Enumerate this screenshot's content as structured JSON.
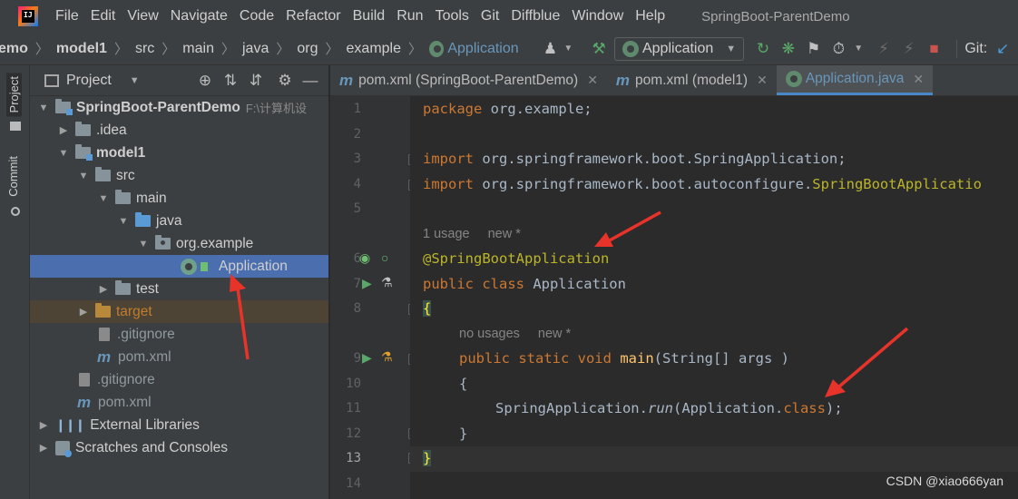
{
  "menubar": {
    "items": [
      "File",
      "Edit",
      "View",
      "Navigate",
      "Code",
      "Refactor",
      "Build",
      "Run",
      "Tools",
      "Git",
      "Diffblue",
      "Window",
      "Help"
    ],
    "window_title": "SpringBoot-ParentDemo"
  },
  "breadcrumb": {
    "project_fragment": "emo",
    "items": [
      "model1",
      "src",
      "main",
      "java",
      "org",
      "example"
    ],
    "current": "Application"
  },
  "toolbar": {
    "run_config": "Application",
    "git_label": "Git:"
  },
  "left_strip": {
    "project_tab": "Project",
    "commit_tab": "Commit"
  },
  "project_panel": {
    "title": "Project",
    "tree": [
      {
        "label": "SpringBoot-ParentDemo",
        "hint": "F:\\计算机设"
      },
      {
        "label": ".idea"
      },
      {
        "label": "model1"
      },
      {
        "label": "src"
      },
      {
        "label": "main"
      },
      {
        "label": "java"
      },
      {
        "label": "org.example"
      },
      {
        "label": "Application"
      },
      {
        "label": "test"
      },
      {
        "label": "target"
      },
      {
        "label": ".gitignore"
      },
      {
        "label": "pom.xml"
      },
      {
        "label": ".gitignore"
      },
      {
        "label": "pom.xml"
      },
      {
        "label": "External Libraries"
      },
      {
        "label": "Scratches and Consoles"
      }
    ]
  },
  "editor": {
    "tabs": [
      {
        "label": "pom.xml (SpringBoot-ParentDemo)"
      },
      {
        "label": "pom.xml (model1)"
      },
      {
        "label": "Application.java"
      }
    ],
    "line_numbers": [
      "1",
      "2",
      "3",
      "4",
      "5",
      "6",
      "7",
      "8",
      "9",
      "10",
      "11",
      "12",
      "13",
      "14"
    ],
    "hints": {
      "usage": "1 usage",
      "new_1": "new *",
      "no_usages": "no usages",
      "new_2": "new *"
    },
    "code": {
      "l1_kw": "package",
      "l1_rest": " org.example;",
      "l3_kw": "import",
      "l3_rest": " org.springframework.boot.SpringApplication;",
      "l4_kw": "import",
      "l4_rest": " org.springframework.boot.autoconfigure.",
      "l4_ann": "SpringBootApplicatio",
      "l6": "@SpringBootApplication",
      "l7_kw": "public class",
      "l7_rest": " Application",
      "l8": "{",
      "l9_kw": "public static void",
      "l9_fn": "main",
      "l9_rest": "(String[] args )",
      "l10": "{",
      "l11_a": "SpringApplication.",
      "l11_run": "run",
      "l11_b": "(Application.",
      "l11_kw": "class",
      "l11_c": ");",
      "l12": "}",
      "l13": "}"
    }
  },
  "watermark": "CSDN @xiao666yan",
  "colors": {
    "accent": "#4b6eaf",
    "keyword": "#cc7832",
    "annotation": "#bbb529",
    "annotation_arrow": "#e8332a"
  }
}
